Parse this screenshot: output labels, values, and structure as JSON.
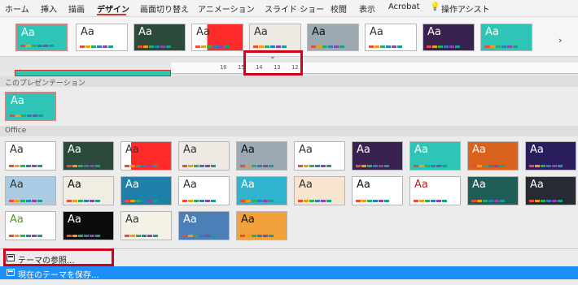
{
  "tabs": [
    "ホーム",
    "挿入",
    "描画",
    "デザイン",
    "画面切り替え",
    "アニメーション",
    "スライド ショー",
    "校閲",
    "表示",
    "Acrobat",
    "操作アシスト"
  ],
  "active_tab": "デザイン",
  "ruler_numbers": [
    "16",
    "15",
    "14",
    "13",
    "12"
  ],
  "ribbon_thumb_label": "Aa",
  "sections": {
    "current": "このプレゼンテーション",
    "office": "Office"
  },
  "menu": {
    "browse": "テーマの参照...",
    "save": "現在のテーマを保存..."
  },
  "colors": {
    "accent_red": "#d0021b",
    "selection_blue": "#1e8ff6",
    "teal": "#2ec4b6"
  },
  "icons": {
    "assist": "lightbulb-icon",
    "chevron": "chevron-down-icon",
    "next": "chevron-right-icon",
    "browse": "folder-icon",
    "save": "save-icon"
  }
}
